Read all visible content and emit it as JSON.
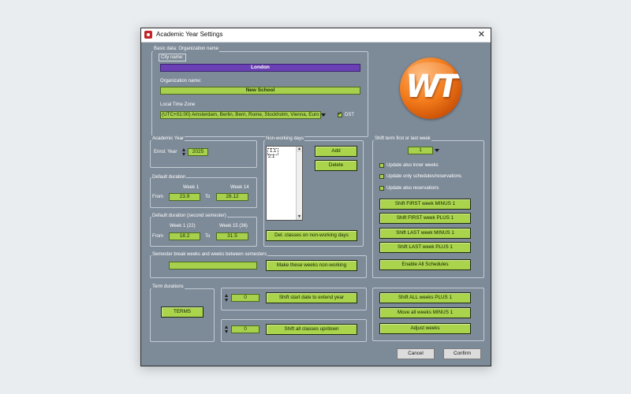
{
  "window": {
    "title": "Academic Year Settings"
  },
  "basic": {
    "group_label": "Basic data: Organization name",
    "city_label": "City name:",
    "city_value": "London",
    "org_label": "Organization name:",
    "org_value": "New School",
    "tz_label": "Local Time Zone",
    "tz_value": "(UTC+01:00) Amsterdam, Berlin, Bern, Rome, Stockholm, Vienna, Euro",
    "dst_label": "DST",
    "dst_checked": true
  },
  "academic_year": {
    "group_label": "Academic Year",
    "enrol_label": "Enrol. Year",
    "enrol_value": "2025"
  },
  "default_duration": {
    "group_label": "Default duration",
    "week_start_label": "Week 1",
    "week_end_label": "Week 14",
    "from_label": "From",
    "from_value": "23.9",
    "to_label": "To",
    "to_value": "28.12"
  },
  "default_duration_2": {
    "group_label": "Default duration (second semester)",
    "week_start_label": "Week 1 (22)",
    "week_end_label": "Week 15 (36)",
    "from_label": "From",
    "from_value": "18.2",
    "to_label": "To",
    "to_value": "31.5"
  },
  "non_working": {
    "group_label": "Non-working days",
    "items": [
      "1.1",
      "2.1"
    ],
    "add_label": "Add",
    "delete_label": "Delete",
    "del_classes_label": "Del. classes on non-working days"
  },
  "shift": {
    "group_label": "Shift term first or last week",
    "week_value": "1",
    "check_inner_label": "Update also inner weeks",
    "check_schedules_label": "Update only schedules/reservations",
    "check_reservations_label": "Update also reservations",
    "first_minus_label": "Shift FIRST week MINUS 1",
    "first_plus_label": "Shift FIRST week PLUS 1",
    "last_minus_label": "Shift LAST week MINUS 1",
    "last_plus_label": "Shift LAST week PLUS 1",
    "enable_all_label": "Enable All Schedules"
  },
  "semester_break": {
    "group_label": "Semester break weeks and weeks between semesters",
    "value": "",
    "make_label": "Make these weeks non-working"
  },
  "term": {
    "group_label": "Term durations",
    "terms_label": "TERMS"
  },
  "extend": {
    "value": "0",
    "button_label": "Shift start date to extend year"
  },
  "shift_classes": {
    "value": "0",
    "button_label": "Shift all classes up/down"
  },
  "weeks_actions": {
    "all_plus_label": "Shift ALL weeks PLUS 1",
    "all_minus_label": "Move all weeks MINUS 1",
    "adjust_label": "Adjust weeks"
  },
  "footer": {
    "cancel_label": "Cancel",
    "confirm_label": "Confirm"
  },
  "logo": {
    "text": "WT",
    "icon": "wt-logo"
  },
  "colors": {
    "window_bg": "#7d8a98",
    "field_green": "#a7d14c",
    "button_green": "#a9d44c",
    "selection_purple": "#6b40b5",
    "logo_orange": "#f27a1a"
  }
}
